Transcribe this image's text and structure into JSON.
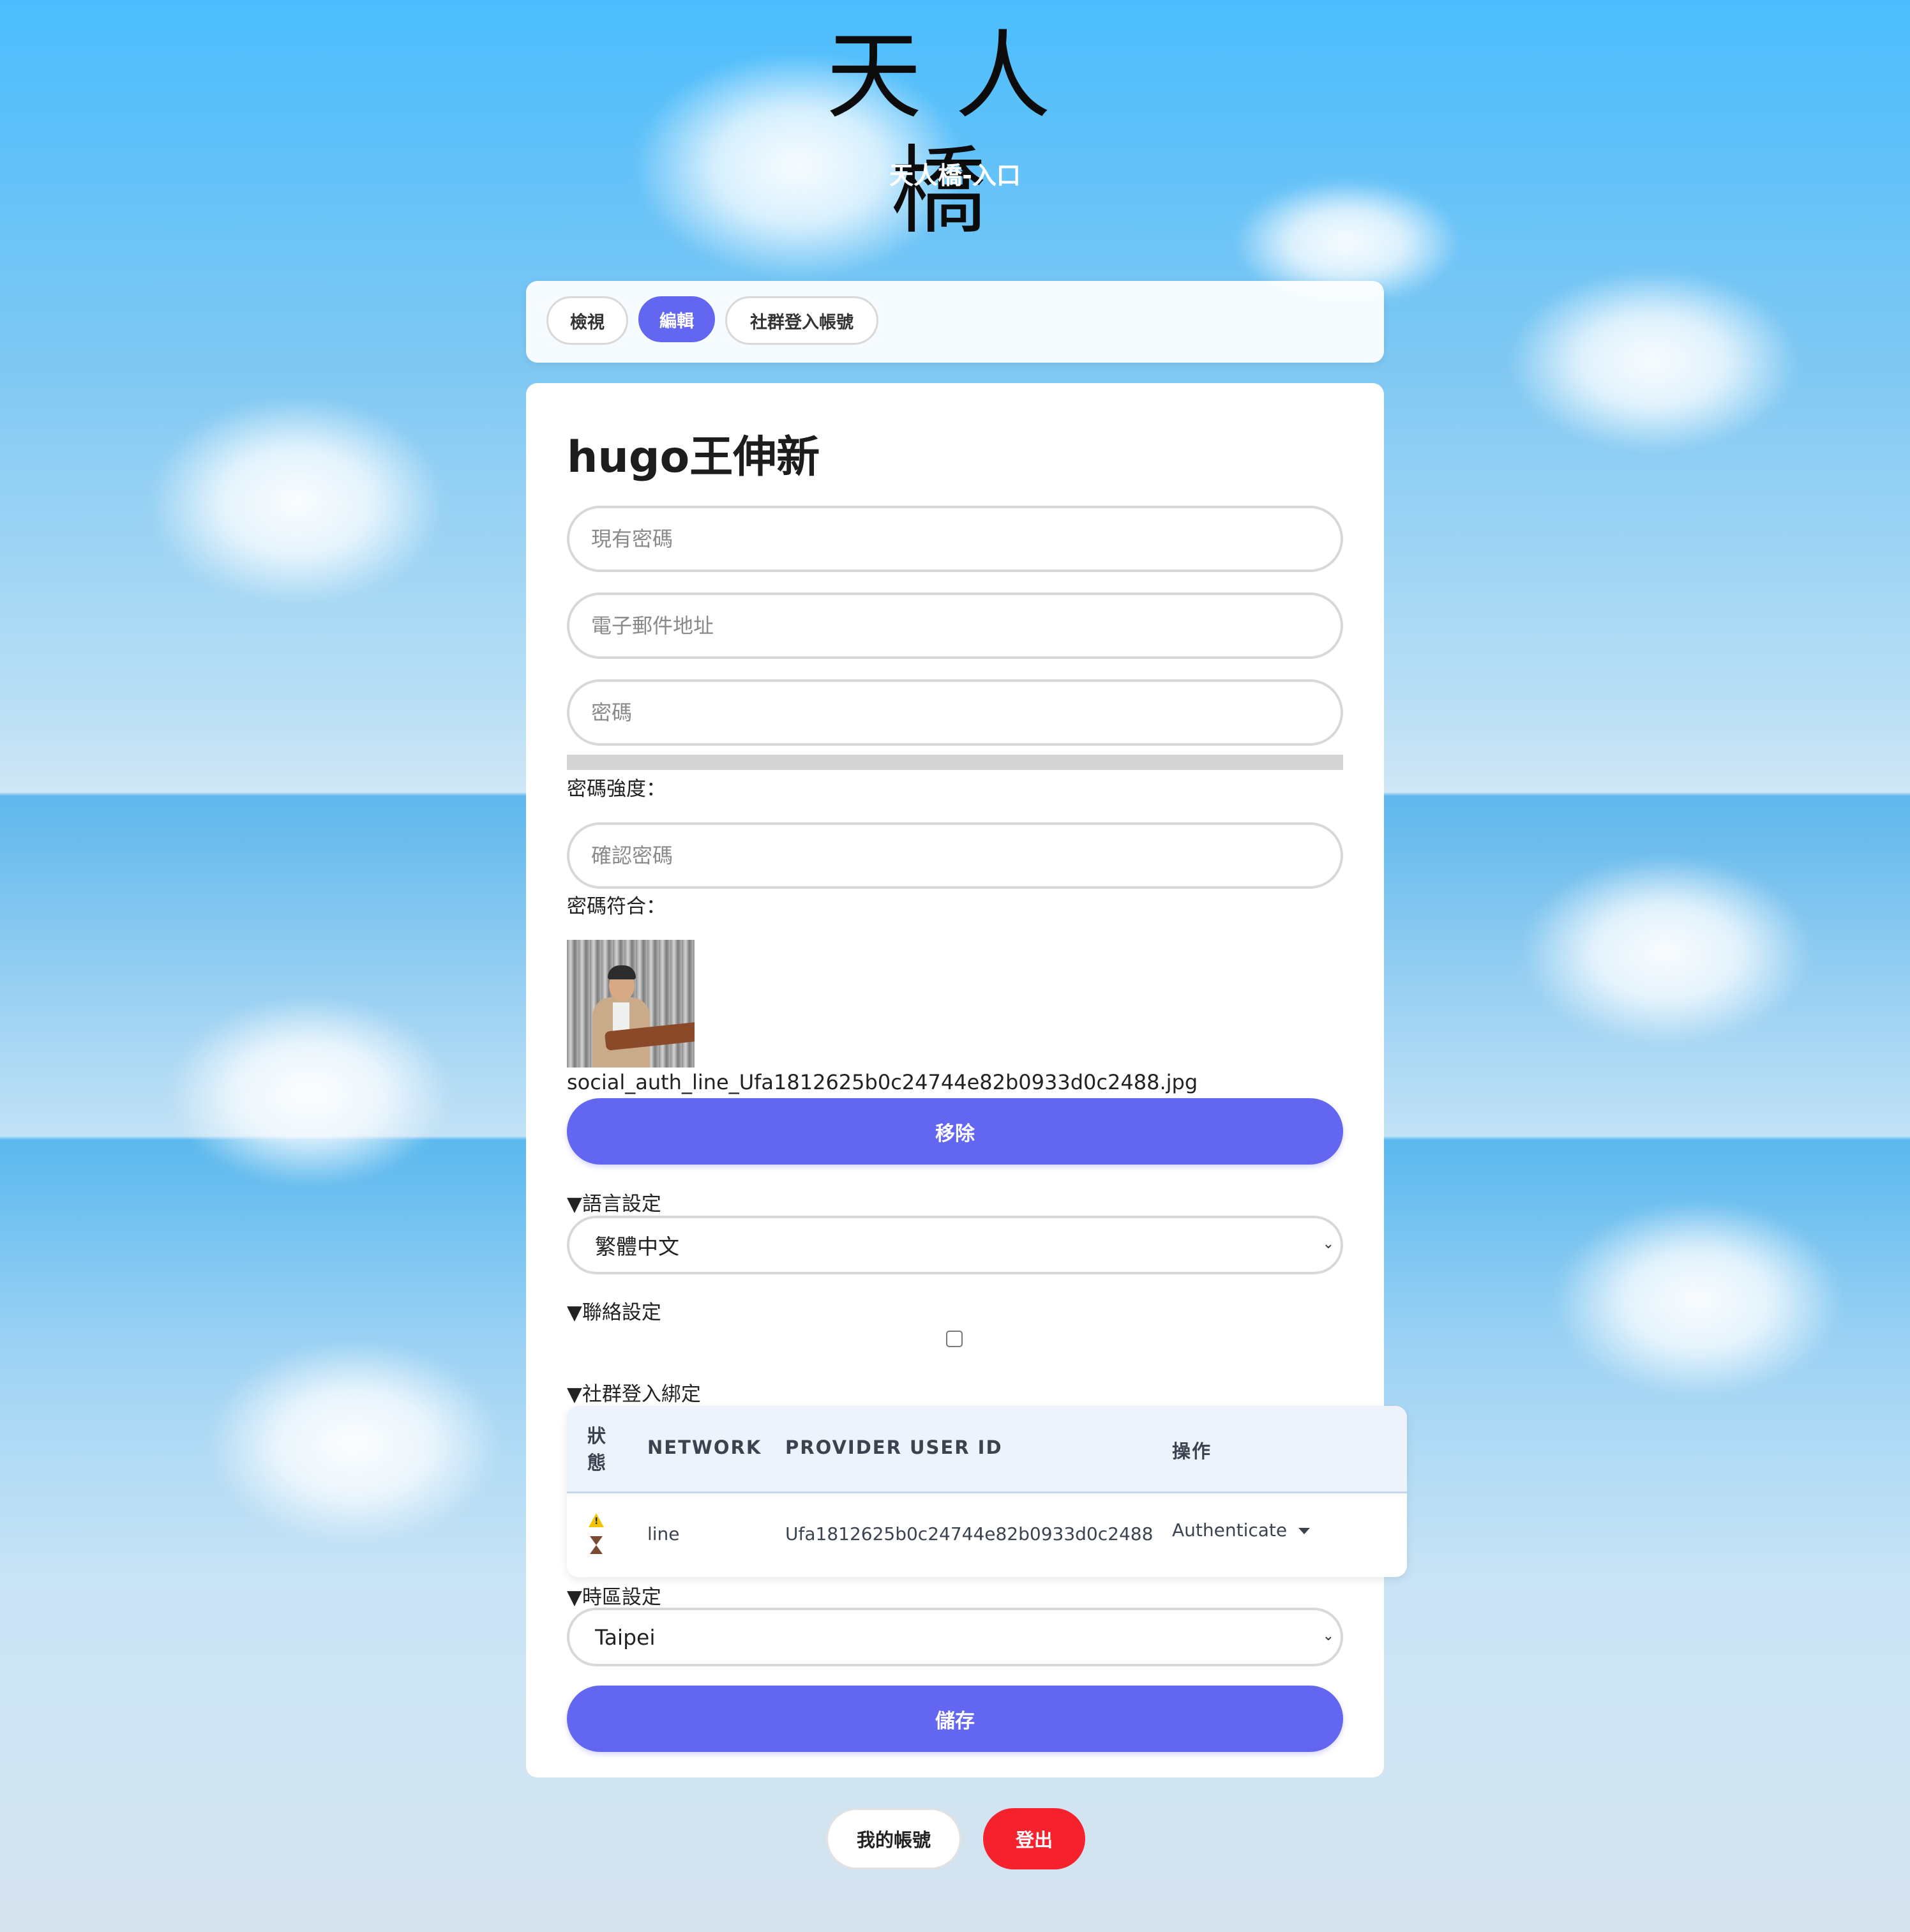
{
  "header": {
    "logo_text": "天人橋",
    "subtitle": "天人橋-入口"
  },
  "tabs": [
    {
      "label": "檢視",
      "active": false
    },
    {
      "label": "編輯",
      "active": true
    },
    {
      "label": "社群登入帳號",
      "active": false
    }
  ],
  "profile": {
    "username": "hugo王伸新",
    "current_password_placeholder": "現有密碼",
    "email_placeholder": "電子郵件地址",
    "password_placeholder": "密碼",
    "password_strength_label": "密碼強度：",
    "confirm_password_placeholder": "確認密碼",
    "password_match_label": "密碼符合：",
    "photo_filename": "social_auth_line_Ufa1812625b0c24744e82b0933d0c2488.jpg",
    "remove_button": "移除"
  },
  "language": {
    "heading": "▼語言設定",
    "selected": "繁體中文"
  },
  "contact": {
    "heading": "▼聯絡設定",
    "checked": false
  },
  "social": {
    "heading": "▼社群登入綁定",
    "columns": [
      "狀\n態",
      "NETWORK",
      "PROVIDER USER ID",
      "操作"
    ],
    "rows": [
      {
        "status_icons": [
          "warning-icon",
          "hourglass-icon"
        ],
        "network": "line",
        "provider_user_id": "Ufa1812625b0c24744e82b0933d0c2488",
        "action": "Authenticate"
      }
    ]
  },
  "timezone": {
    "heading": "▼時區設定",
    "selected": "Taipei"
  },
  "save_button": "儲存",
  "footer": {
    "my_account": "我的帳號",
    "logout": "登出"
  },
  "colors": {
    "accent": "#6366f1",
    "logout": "#f5222d",
    "sky_top": "#4bbdfd",
    "sky_bottom": "#d5e3ee"
  }
}
